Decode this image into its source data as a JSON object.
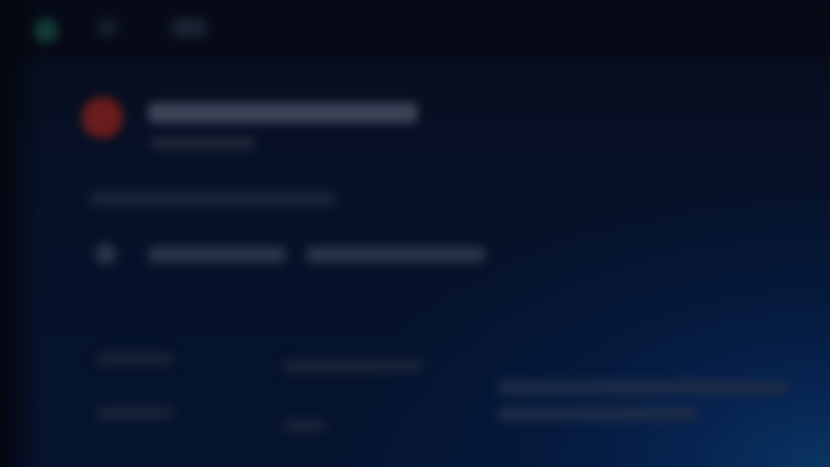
{
  "theme": {
    "background": "#060b18",
    "accent_glow": "#0a3563",
    "logo_color": "#123a36",
    "avatar_color": "#6a1c1c"
  },
  "topbar": {
    "logo_icon": "app-logo-icon",
    "menu_icon": "menu-icon",
    "pill_label": ""
  },
  "header": {
    "avatar_icon": "avatar-icon",
    "title": "",
    "subtitle": ""
  },
  "description": "",
  "actions": {
    "icon": "action-icon",
    "primary_label": "",
    "secondary_label": ""
  },
  "details": {
    "rows": [
      {
        "label": "",
        "value": ""
      },
      {
        "label": "",
        "value": ""
      }
    ],
    "note_lines": [
      "",
      ""
    ]
  }
}
